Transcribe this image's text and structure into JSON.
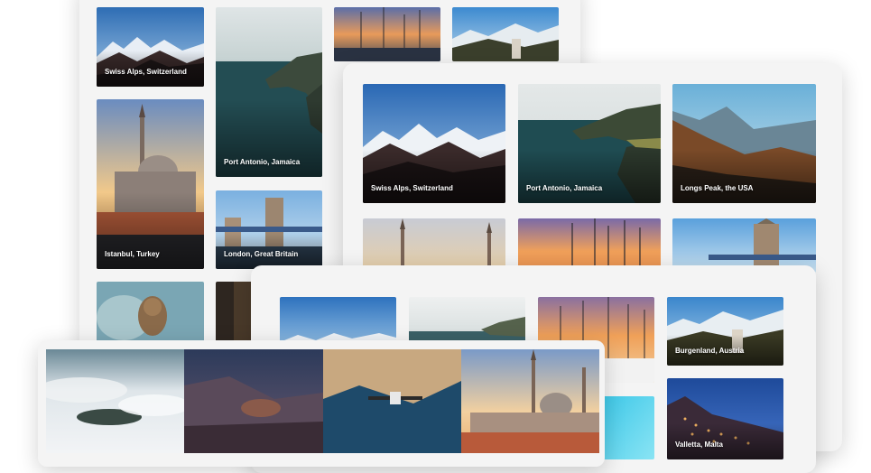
{
  "gallery_back": {
    "tiles": [
      {
        "caption": "Swiss Alps, Switzerland"
      },
      {
        "caption": "Port Antonio, Jamaica"
      },
      {
        "caption": ""
      },
      {
        "caption": ""
      },
      {
        "caption": "Istanbul, Turkey"
      },
      {
        "caption": "London, Great Britain"
      },
      {
        "caption": ""
      },
      {
        "caption": ""
      }
    ]
  },
  "gallery_middle": {
    "tiles": [
      {
        "caption": "Swiss Alps, Switzerland"
      },
      {
        "caption": "Port Antonio, Jamaica"
      },
      {
        "caption": "Longs Peak, the USA"
      },
      {
        "caption": ""
      },
      {
        "caption": ""
      },
      {
        "caption": ""
      }
    ]
  },
  "gallery_front_masonry": {
    "tiles": [
      {
        "caption": ""
      },
      {
        "caption": ""
      },
      {
        "caption": ""
      },
      {
        "caption": "Burgenland, Austria"
      },
      {
        "caption": ""
      },
      {
        "caption": "Valletta, Malta"
      }
    ]
  },
  "gallery_strip": {
    "tiles": [
      {
        "caption": ""
      },
      {
        "caption": ""
      },
      {
        "caption": ""
      },
      {
        "caption": ""
      }
    ]
  }
}
